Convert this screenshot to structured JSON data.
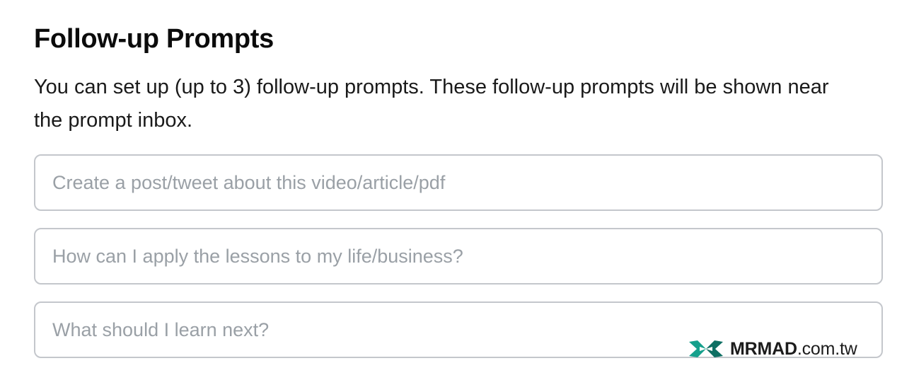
{
  "section": {
    "title": "Follow-up Prompts",
    "description": "You can set up (up to 3) follow-up prompts. These follow-up prompts will be shown near the prompt inbox."
  },
  "prompts": [
    {
      "value": "",
      "placeholder": "Create a post/tweet about this video/article/pdf"
    },
    {
      "value": "",
      "placeholder": "How can I apply the lessons to my life/business?"
    },
    {
      "value": "",
      "placeholder": "What should I learn next?"
    }
  ],
  "watermark": {
    "brand": "MRMAD",
    "domain": ".com.tw",
    "icon": "mrmad-logo-icon",
    "color": "#15a08c"
  }
}
